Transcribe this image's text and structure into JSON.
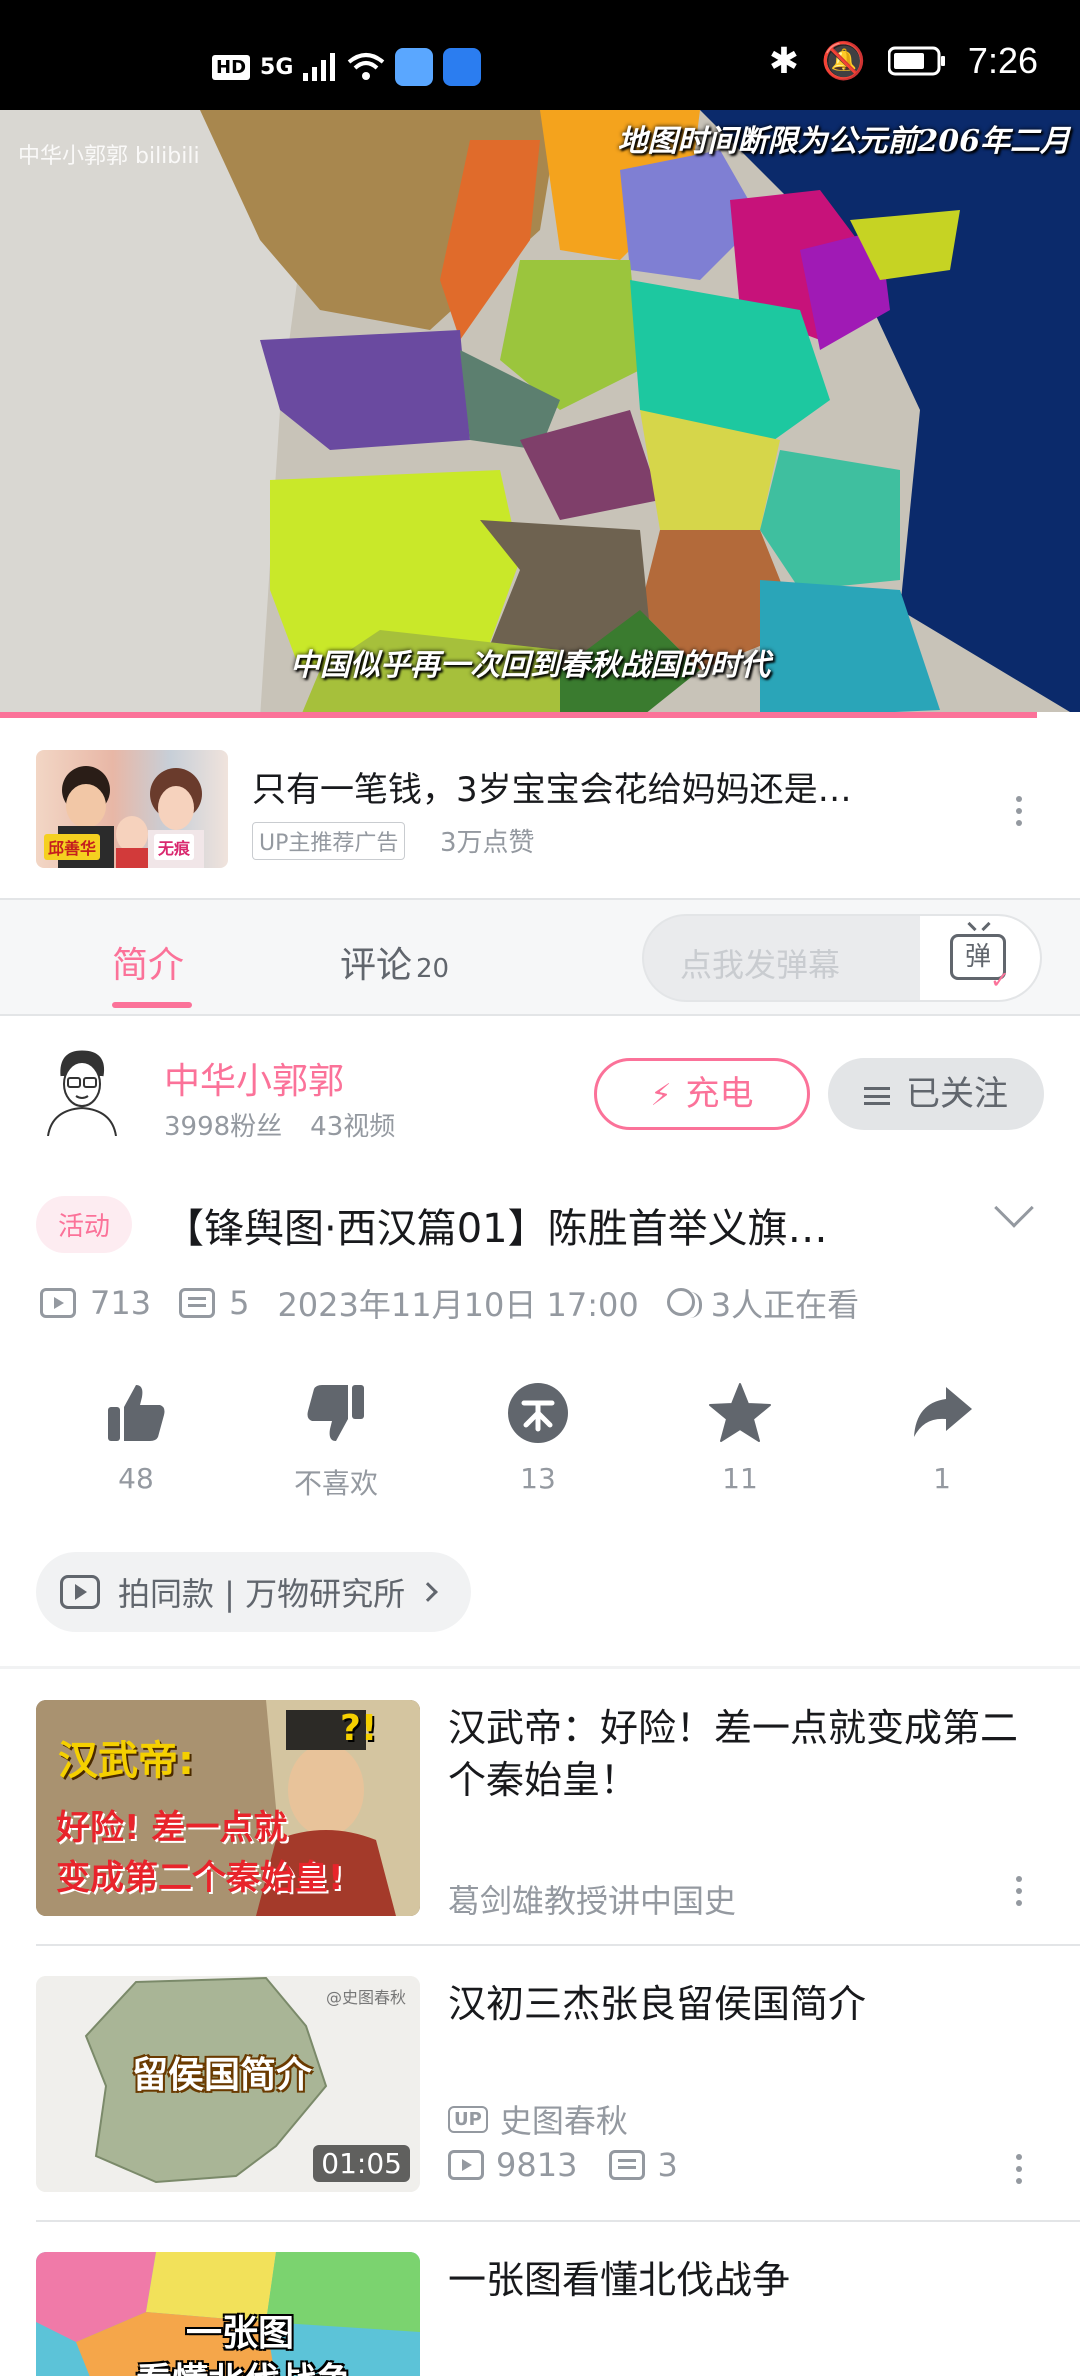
{
  "status_bar": {
    "left_badges": [
      "HD",
      "5G"
    ],
    "time": "7:26"
  },
  "player": {
    "watermark": "中华小郭郭 bilibili",
    "top_caption": "地图时间断限为公元前206年二月",
    "subtitle": "中国似乎再一次回到春秋战国的时代",
    "progress": 0.96
  },
  "ad": {
    "thumb_tag_left": "邱善华",
    "thumb_tag_right": "无痕",
    "title": "只有一笔钱，3岁宝宝会花给妈妈还是…",
    "badge": "UP主推荐广告",
    "likes": "3万点赞"
  },
  "tabs": {
    "intro": "简介",
    "comments": "评论",
    "comments_count": "20",
    "danmaku_placeholder": "点我发弹幕",
    "danmaku_button": "弹"
  },
  "uploader": {
    "name": "中华小郭郭",
    "fans": "3998粉丝",
    "videos": "43视频",
    "charge_label": "充电",
    "follow_label": "已关注"
  },
  "video": {
    "activity_tag": "活动",
    "title": "【锋舆图·西汉篇01】陈胜首举义旗…",
    "views": "713",
    "danmaku_count": "5",
    "date": "2023年11月10日 17:00",
    "watching": "3人正在看"
  },
  "actions": [
    {
      "name": "like",
      "label": "48"
    },
    {
      "name": "dislike",
      "label": "不喜欢"
    },
    {
      "name": "coin",
      "label": "13"
    },
    {
      "name": "favorite",
      "label": "11"
    },
    {
      "name": "share",
      "label": "1"
    }
  ],
  "chip": {
    "label": "拍同款 | 万物研究所"
  },
  "related": [
    {
      "title": "汉武帝：好险！差一点就变成第二个秦始皇！",
      "author": "葛剑雄教授讲中国史",
      "thumb_text_top": "汉武帝:",
      "thumb_text_mid": "好险! 差一点就",
      "thumb_text_bot": "变成第二个秦始皇!",
      "thumb_badge": "?!"
    },
    {
      "title": "汉初三杰张良留侯国简介",
      "author": "史图春秋",
      "views": "9813",
      "danmaku": "3",
      "duration": "01:05",
      "thumb_text": "留侯国简介",
      "thumb_watermark": "@史图春秋",
      "up_tag": "UP"
    },
    {
      "title": "一张图看懂北伐战争",
      "thumb_text": "一张图",
      "thumb_text2": "看懂北伐战争"
    }
  ],
  "colors": {
    "accent": "#fb7299",
    "text_primary": "#18191c",
    "text_secondary": "#9499a0"
  }
}
